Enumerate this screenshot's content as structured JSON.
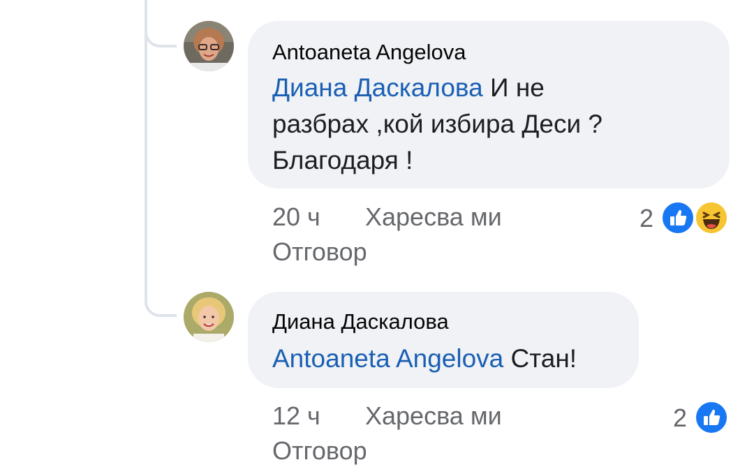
{
  "comments": [
    {
      "author": "Antoaneta Angelova",
      "mention": "Диана Даскалова",
      "text_line1_rest": " И не",
      "text_line2": "разбрах ,кой избира Деси ?",
      "text_line3": "Благодаря !",
      "time": "20 ч",
      "like_label": "Харесва ми",
      "reply_label": "Отговор",
      "reaction_count": "2",
      "reactions": [
        "like-icon",
        "haha-icon"
      ]
    },
    {
      "author": "Диана Даскалова",
      "mention": "Antoaneta Angelova",
      "text_rest": " Стан!",
      "time": "12 ч",
      "like_label": "Харесва ми",
      "reply_label": "Отговор",
      "reaction_count": "2",
      "reactions": [
        "like-icon"
      ]
    }
  ],
  "colors": {
    "mention": "#1a5fb4",
    "bubble": "#f0f2f5",
    "meta": "#65676b",
    "like": "#1877f2",
    "haha": "#f7c531"
  }
}
